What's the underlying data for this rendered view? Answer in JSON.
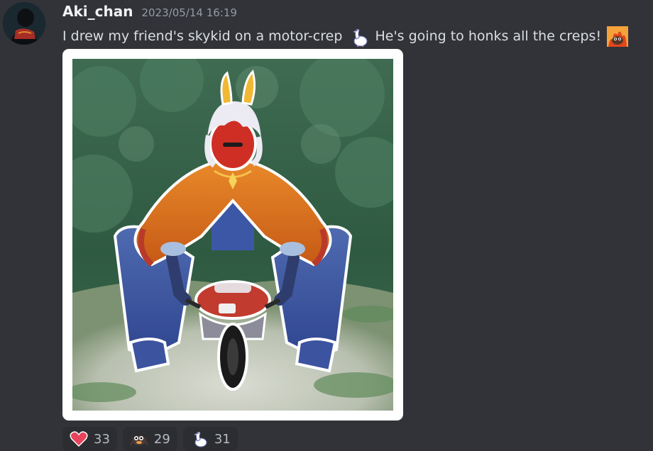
{
  "message": {
    "author": "Aki_chan",
    "timestamp": "2023/05/14 16:19",
    "text_part1": "I drew my friend's skykid on a motor-crep",
    "text_part2": "He's going to honks all the creps!",
    "inline_emojis": [
      "goose-emoji",
      "fire-crab-emoji"
    ]
  },
  "attachment": {
    "type": "image",
    "description_icon": "illustration-skykid-on-motorbike"
  },
  "reactions": [
    {
      "icon": "heart-icon",
      "count": "33",
      "color": "#e8435a"
    },
    {
      "icon": "crab-emoji",
      "count": "29"
    },
    {
      "icon": "goose-emoji",
      "count": "31"
    }
  ]
}
